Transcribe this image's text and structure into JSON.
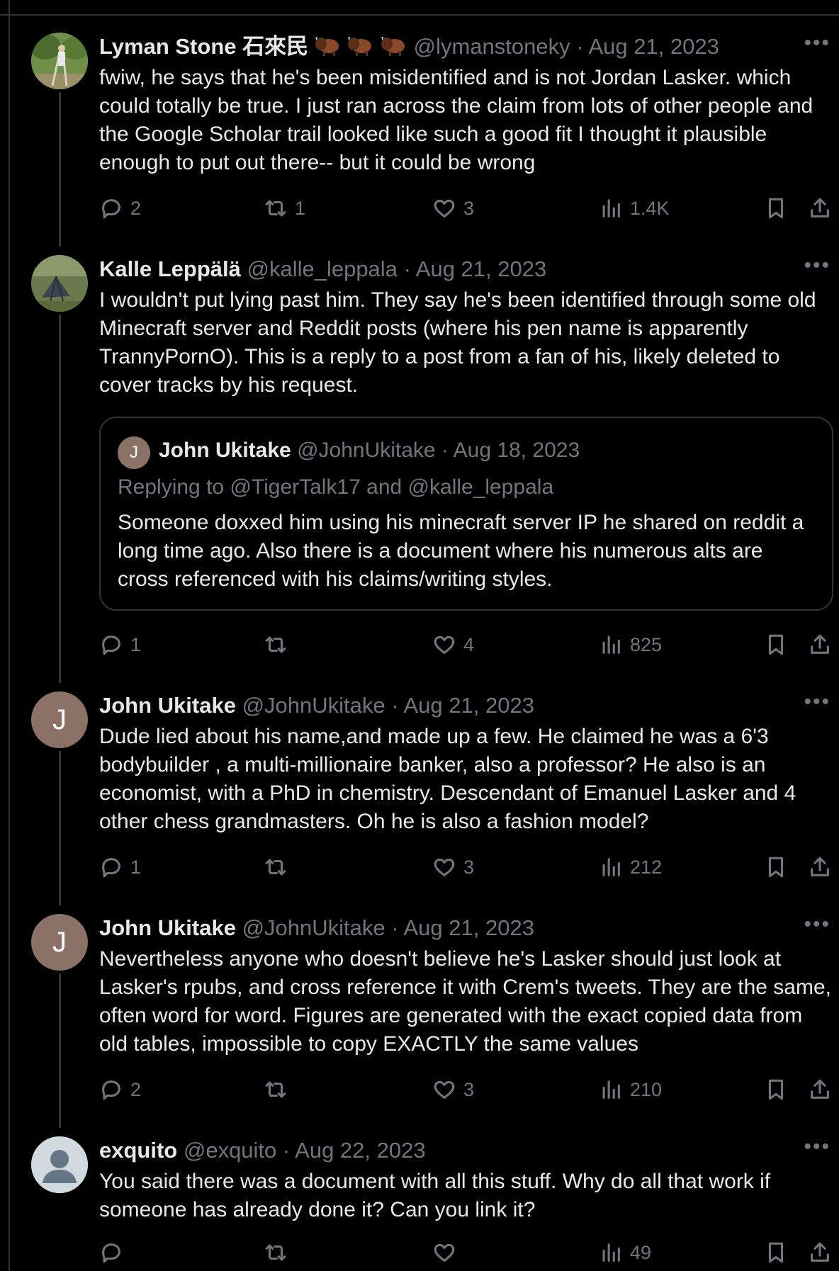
{
  "tweets": [
    {
      "name": "Lyman Stone 石來民",
      "emoji": [
        "bison",
        "bison",
        "bison"
      ],
      "handle": "@lymanstoneky",
      "date": "· Aug 21, 2023",
      "text": "fwiw, he says that he's been misidentified and is not Jordan Lasker. which could totally be true. I just ran across the claim from lots of other people and the Google Scholar trail looked like such a good fit I thought it plausible enough to put out there-- but it could be wrong",
      "replies": "2",
      "reposts": "1",
      "likes": "3",
      "views": "1.4K"
    },
    {
      "name": "Kalle Leppälä",
      "handle": "@kalle_leppala",
      "date": "· Aug 21, 2023",
      "text": "I wouldn't put lying past him. They say he's been identified through some old Minecraft server and Reddit posts (where his pen name is apparently TrannyPornO). This is a reply to a post from a fan of his, likely deleted to cover tracks by his request.",
      "quote": {
        "avatar_letter": "J",
        "name": "John Ukitake",
        "handle": "@JohnUkitake",
        "date": "· Aug 18, 2023",
        "replying": "Replying to @TigerTalk17 and @kalle_leppala",
        "text": "Someone doxxed him using his minecraft server IP he shared on reddit a long time ago. Also there is a document where his numerous alts are cross referenced with his claims/writing styles."
      },
      "replies": "1",
      "reposts": "",
      "likes": "4",
      "views": "825"
    },
    {
      "avatar_letter": "J",
      "name": "John Ukitake",
      "handle": "@JohnUkitake",
      "date": "· Aug 21, 2023",
      "text": "Dude lied about his name,and made up a few. He claimed he was a 6'3 bodybuilder , a multi-millionaire banker, also a professor? He also is an economist, with a PhD in chemistry. Descendant of Emanuel Lasker and 4 other chess grandmasters. Oh he is also a fashion model?",
      "replies": "1",
      "reposts": "",
      "likes": "3",
      "views": "212"
    },
    {
      "avatar_letter": "J",
      "name": "John Ukitake",
      "handle": "@JohnUkitake",
      "date": "· Aug 21, 2023",
      "text": "Nevertheless anyone who doesn't believe he's Lasker should just look at Lasker's rpubs, and cross reference it with Crem's tweets. They are the same, often word for word. Figures are generated with the exact copied data from old tables, impossible to copy EXACTLY the same values",
      "replies": "2",
      "reposts": "",
      "likes": "3",
      "views": "210"
    },
    {
      "name": "exquito",
      "handle": "@exquito",
      "date": "· Aug 22, 2023",
      "text": "You said there was a document with all this stuff. Why do all that work if someone has already done it? Can you link it?",
      "replies": "",
      "reposts": "",
      "likes": "",
      "views": "49"
    }
  ],
  "more_icon": "•••",
  "colors": {
    "background": "#000000",
    "text": "#e7e9ea",
    "secondary": "#71767b",
    "border": "#2f3336"
  }
}
